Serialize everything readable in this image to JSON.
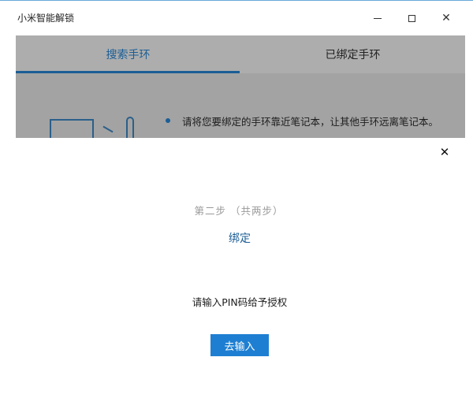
{
  "window": {
    "title": "小米智能解锁",
    "minimize_symbol": "",
    "maximize_symbol": "",
    "close_symbol": "✕"
  },
  "tabs": [
    {
      "label": "搜索手环",
      "active": true
    },
    {
      "label": "已绑定手环",
      "active": false
    }
  ],
  "background_content": {
    "instruction": "请将您要绑定的手环靠近笔记本，让其他手环远离笔记本。"
  },
  "dialog": {
    "close_symbol": "✕",
    "step_text": "第二步  （共两步）",
    "title": "绑定",
    "prompt": "请输入PIN码给予授权",
    "button_label": "去输入"
  },
  "colors": {
    "accent": "#1b5e96",
    "button": "#1e7fd2",
    "overlay": "#adadad"
  }
}
